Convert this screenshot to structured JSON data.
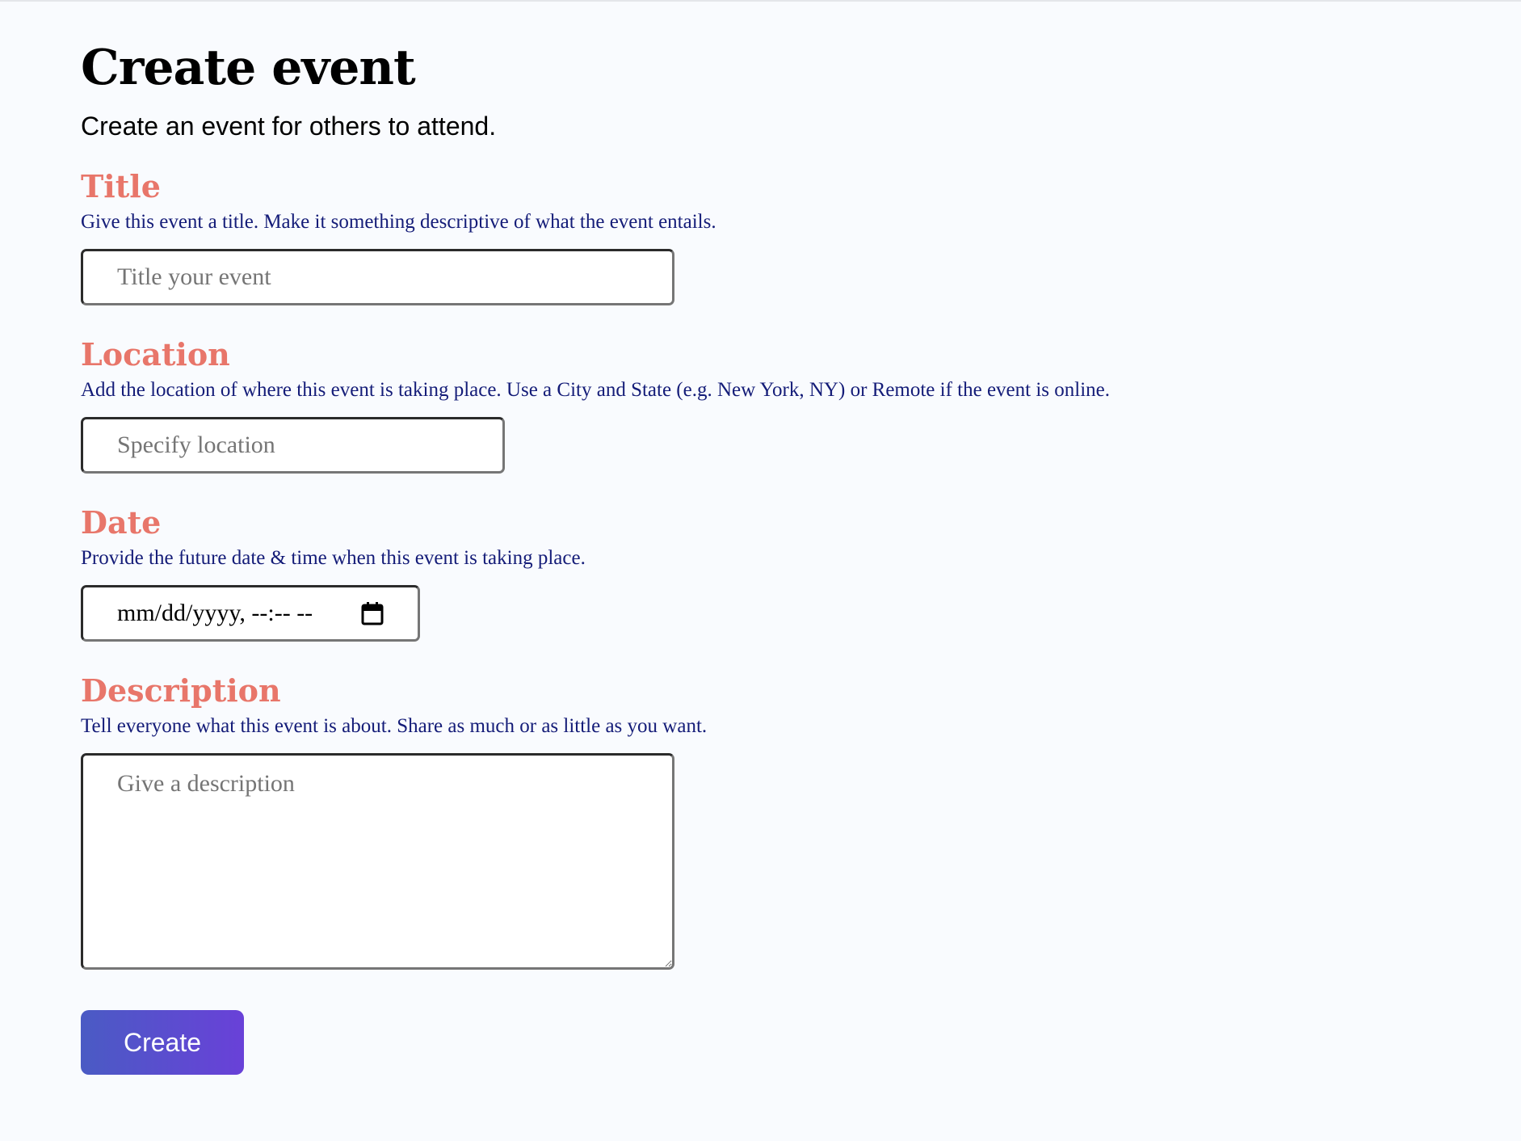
{
  "page": {
    "title": "Create event",
    "subtitle": "Create an event for others to attend."
  },
  "form": {
    "title_field": {
      "label": "Title",
      "help": "Give this event a title. Make it something descriptive of what the event entails.",
      "placeholder": "Title your event",
      "value": ""
    },
    "location_field": {
      "label": "Location",
      "help": "Add the location of where this event is taking place. Use a City and State (e.g. New York, NY) or Remote if the event is online.",
      "placeholder": "Specify location",
      "value": ""
    },
    "date_field": {
      "label": "Date",
      "help": "Provide the future date & time when this event is taking place.",
      "display_value": "mm/dd/yyyy, --:-- --",
      "icon": "calendar-icon"
    },
    "description_field": {
      "label": "Description",
      "help": "Tell everyone what this event is about. Share as much or as little as you want.",
      "placeholder": "Give a description",
      "value": ""
    },
    "submit": {
      "label": "Create"
    }
  },
  "colors": {
    "background": "#f9fbfe",
    "label": "#e8766a",
    "help_text": "#141c78",
    "button_gradient_start": "#4a5bc4",
    "button_gradient_end": "#6941d8"
  }
}
